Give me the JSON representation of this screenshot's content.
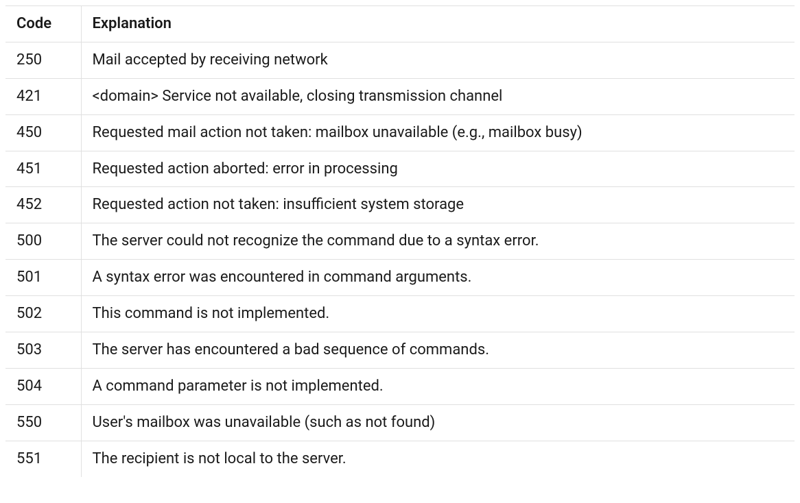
{
  "table": {
    "headers": {
      "code": "Code",
      "explanation": "Explanation"
    },
    "rows": [
      {
        "code": "250",
        "explanation": "Mail accepted by receiving network"
      },
      {
        "code": "421",
        "explanation": "<domain> Service not available, closing transmission channel"
      },
      {
        "code": "450",
        "explanation": "Requested mail action not taken: mailbox unavailable (e.g., mailbox busy)"
      },
      {
        "code": "451",
        "explanation": "Requested action aborted: error in processing"
      },
      {
        "code": "452",
        "explanation": "Requested action not taken: insufficient system storage"
      },
      {
        "code": "500",
        "explanation": "The server could not recognize the command due to a syntax error."
      },
      {
        "code": "501",
        "explanation": "A syntax error was encountered in command arguments."
      },
      {
        "code": "502",
        "explanation": "This command is not implemented."
      },
      {
        "code": "503",
        "explanation": "The server has encountered a bad sequence of commands."
      },
      {
        "code": "504",
        "explanation": "A command parameter is not implemented."
      },
      {
        "code": "550",
        "explanation": "User's mailbox was unavailable (such as not found)"
      },
      {
        "code": "551",
        "explanation": "The recipient is not local to the server."
      }
    ]
  }
}
